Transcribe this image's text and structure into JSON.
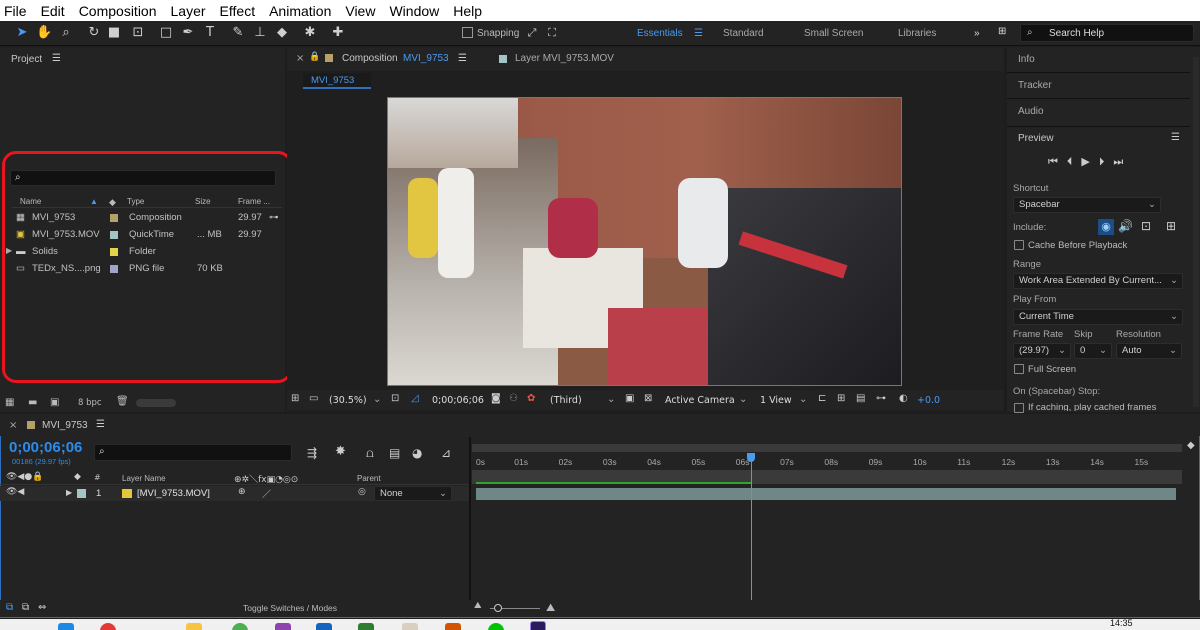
{
  "menu": [
    "File",
    "Edit",
    "Composition",
    "Layer",
    "Effect",
    "Animation",
    "View",
    "Window",
    "Help"
  ],
  "toolbar": {
    "snapping_label": "Snapping",
    "workspaces": [
      "Essentials",
      "Standard",
      "Small Screen",
      "Libraries"
    ],
    "search_help": "Search Help"
  },
  "project": {
    "title": "Project",
    "columns": {
      "name": "Name",
      "type": "Type",
      "size": "Size",
      "frame": "Frame ..."
    },
    "items": [
      {
        "name": "MVI_9753",
        "type": "Composition",
        "size": "",
        "frame": "29.97",
        "color": "#b5a26a"
      },
      {
        "name": "MVI_9753.MOV",
        "type": "QuickTime",
        "size": "... MB",
        "frame": "29.97",
        "color": "#a3c4c4"
      },
      {
        "name": "Solids",
        "type": "Folder",
        "size": "",
        "frame": "",
        "color": "#e3d34c"
      },
      {
        "name": "TEDx_NS....png",
        "type": "PNG file",
        "size": "70 KB",
        "frame": "",
        "color": "#9ea5c9"
      }
    ],
    "bpc": "8 bpc"
  },
  "composition": {
    "tab_label": "Composition",
    "tab_name": "MVI_9753",
    "layer_tab": "Layer MVI_9753.MOV",
    "flow_tab": "MVI_9753",
    "zoom": "(30.5%)",
    "timecode": "0;00;06;06",
    "resolution": "(Third)",
    "camera": "Active Camera",
    "views": "1 View",
    "exposure": "+0.0"
  },
  "right_panel": {
    "tabs": [
      "Info",
      "Tracker",
      "Audio"
    ],
    "preview_title": "Preview",
    "shortcut_label": "Shortcut",
    "shortcut_value": "Spacebar",
    "include_label": "Include:",
    "cache_label": "Cache Before Playback",
    "range_label": "Range",
    "range_value": "Work Area Extended By Current...",
    "playfrom_label": "Play From",
    "playfrom_value": "Current Time",
    "framerate_label": "Frame Rate",
    "skip_label": "Skip",
    "resolution_label": "Resolution",
    "framerate_value": "(29.97)",
    "skip_value": "0",
    "resolution_value": "Auto",
    "fullscreen_label": "Full Screen",
    "onstop_label": "On (Spacebar) Stop:",
    "ifcaching_label": "If caching, play cached frames"
  },
  "timeline": {
    "comp_name": "MVI_9753",
    "timecode": "0;00;06;06",
    "frames": "00186 (29.97 fps)",
    "col_layer_name": "Layer Name",
    "col_parent": "Parent",
    "layer_index": "1",
    "layer_name": "[MVI_9753.MOV]",
    "parent_value": "None",
    "ticks": [
      "0s",
      "01s",
      "02s",
      "03s",
      "04s",
      "05s",
      "06s",
      "07s",
      "08s",
      "09s",
      "10s",
      "11s",
      "12s",
      "13s",
      "14s",
      "15s"
    ],
    "footer": "Toggle Switches / Modes",
    "playhead_seconds": 6.2,
    "duration_seconds": 15.8
  },
  "taskbar": {
    "time": "14:35"
  },
  "colors": {
    "accent": "#4a9af0",
    "highlight_box": "#e8141e",
    "timecode_blue": "#2d8ceb",
    "layer_bar": "#6f8786",
    "workarea_green": "#2fa52f"
  }
}
